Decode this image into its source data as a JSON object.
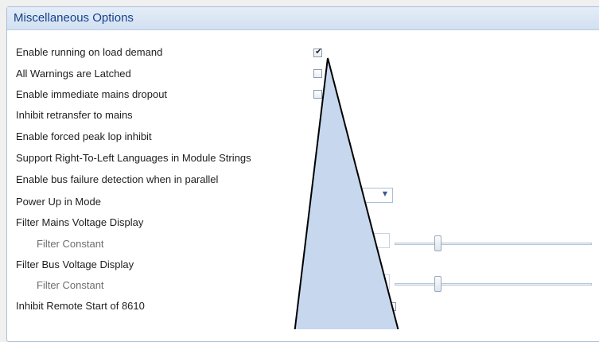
{
  "panel": {
    "title": "Miscellaneous Options"
  },
  "options": [
    {
      "label": "Enable running on load demand",
      "checked": true
    },
    {
      "label": "All Warnings are Latched",
      "checked": false
    },
    {
      "label": "Enable immediate mains dropout",
      "checked": false
    },
    {
      "label": "Inhibit retransfer to mains",
      "checked": false
    },
    {
      "label": "Enable forced peak lop inhibit",
      "checked": false
    },
    {
      "label": "Support Right-To-Left Languages in Module Strings",
      "checked": false
    },
    {
      "label": "Enable bus failure detection when in parallel",
      "checked": false
    },
    {
      "label": "Power Up in Mode",
      "value": ""
    },
    {
      "label": "Filter Mains Voltage Display",
      "checked": false
    },
    {
      "label": "Filter Constant",
      "slider_level": 0.22
    },
    {
      "label": "Filter Bus Voltage Display",
      "checked": false
    },
    {
      "label": "Filter Constant",
      "slider_level": 0.22
    },
    {
      "label": "Inhibit Remote Start of 8610",
      "checked": false
    }
  ],
  "icons": {
    "checkmark": "✔",
    "dropdown_arrow": "▼"
  },
  "colors": {
    "header_text": "#15428b",
    "callout_fill": "#c6d7ee",
    "callout_stroke": "#000000"
  }
}
